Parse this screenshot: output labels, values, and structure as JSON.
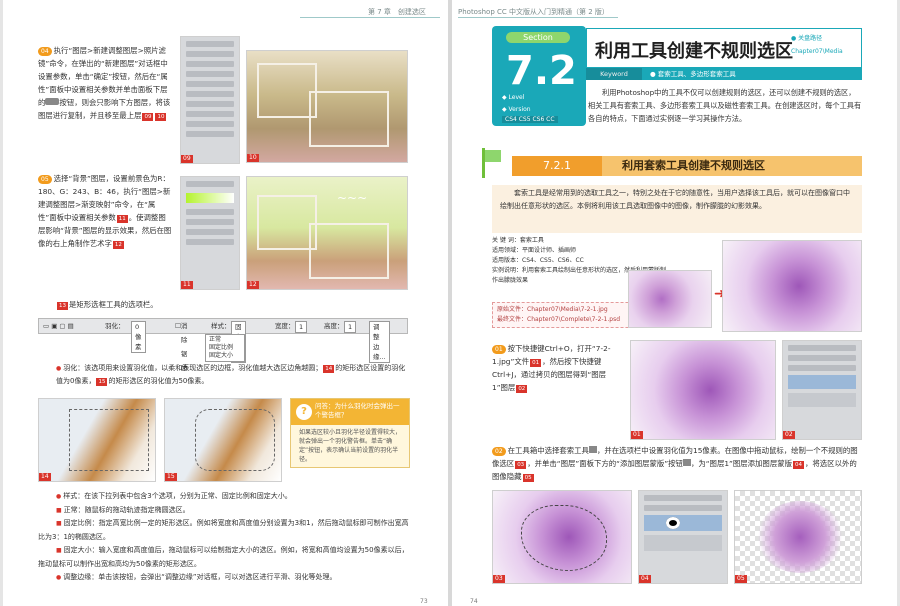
{
  "left": {
    "running_head": "第 7 章　创建选区",
    "p04": {
      "num": "04",
      "text": "执行“图层>新建调整图层>照片滤镜”命令，在弹出的“新建图层”对话框中设置参数，单击“确定”按钮，然后在“属性”面板中设置相关参数并单击面板下层的",
      "text2": "按钮，则会只影响下方图层，将该图层进行复制，并且移至最上层",
      "ref_a": "09",
      "ref_b": "10"
    },
    "p05": {
      "num": "05",
      "text": "选择“背景”图层，设置前景色为R：180、G：243、B：46，执行“图层>新建调整图层>渐变映射”命令，在“属性”面板中设置相关参数",
      "ref_a": "11",
      "text2": "。使调整图层影响“背景”图层的显示效果，然后在图像的右上角制作艺术字",
      "ref_b": "12"
    },
    "caption13": {
      "ref": "13",
      "text": "是矩形选框工具的选项栏。"
    },
    "optbar": {
      "feather_label": "羽化：",
      "feather_value": "0 像素",
      "antialias": "消除锯齿",
      "style_label": "样式：",
      "style_value": "固定比例",
      "width_label": "宽度：",
      "width_value": "1",
      "height_label": "高度：",
      "height_value": "1",
      "refine": "调整边缘..."
    },
    "dropdown": [
      "正常",
      "固定比例",
      "固定大小"
    ],
    "bullet1": {
      "text": "羽化：该选项用来设置羽化值，以柔和表现选区的边框，羽化值越大选区边角越圆；",
      "ref_a": "14",
      "text2": "的矩形选区设置的羽化值为0像素，",
      "ref_b": "15",
      "text3": "的矩形选区的羽化值为50像素。"
    },
    "tip": {
      "head": "问答：为什么羽化时会弹出一个警告框？",
      "body": "如果选区较小且羽化半径设置得较大，就会弹出一个羽化警告框。单击“确定”按钮，表示确认当前设置的羽化半径。"
    },
    "bullet2": "样式：在该下拉列表中包含3个选项，分别为正常、固定比例和固定大小。",
    "b2a": "正常：随鼠标的拖动轨迹指定椭圆选区。",
    "b2b": "固定比例：指定高宽比例一定的矩形选区。例如将宽度和高度值分别设置为3和1，然后拖动鼠标即可制作出宽高比为3：1的椭圆选区。",
    "b2c": "固定大小：输入宽度和高度值后，拖动鼠标可以绘制指定大小的选区。例如，将宽和高值均设置为50像素以后，拖动鼠标可以制作出宽和高均为50像素的矩形选区。",
    "bullet3": "调整边缘：单击该按钮，会弹出“调整边缘”对话框，可以对选区进行平滑、羽化等处理。",
    "figure_tags": [
      "09",
      "10",
      "11",
      "12",
      "13",
      "14",
      "15"
    ],
    "page_number": "73"
  },
  "right": {
    "running_head": "Photoshop CC 中文版从入门到精通（第 2 版）",
    "section": {
      "label": "Section",
      "number": "7.2",
      "level_label": "Level",
      "version_label": "Version",
      "version_value": "CS4 CS5 CS6 CC",
      "title": "利用工具创建不规则选区",
      "side_label": "关盘路径",
      "side_path": "Chapter07\\Media",
      "keyword_label": "Keyword",
      "keywords": "● 套索工具、多边形套索工具"
    },
    "intro_para": "利用Photoshop中的工具不仅可以创建规则的选区，还可以创建不规则的选区，相关工具有套索工具、多边形套索工具以及磁性套索工具。在创建选区时，每个工具有各自的特点，下面通过实例逐一学习其操作方法。",
    "h2": {
      "num": "7.2.1",
      "title": "利用套索工具创建不规则选区"
    },
    "intro_box": "套索工具是经常用到的选取工具之一，特别之处在于它的随意性，当用户选择该工具后，就可以在图像窗口中绘制出任意形状的选区。本例将利用该工具选取图像中的图像，制作朦胧的幻影效果。",
    "info": {
      "keyword": "关 键 词：套索工具",
      "field": "适用领域：平面设计师、插画师",
      "version": "适用版本：CS4、CS5、CS6、CC",
      "content": "实例说明：利用套索工具绘制出任意形状的选区，然后利用蒙版制作出朦胧效果"
    },
    "files": {
      "source": "原始文件：Chapter07\\Media\\7-2-1.jpg",
      "final": "最终文件：Chapter07\\Complete\\7-2-1.psd"
    },
    "s01": {
      "num": "01",
      "text": "按下快捷键Ctrl+O，打开“7-2-1.jpg”文件",
      "ref_a": "01",
      "text2": "，然后按下快捷键Ctrl+J，通过拷贝的图层得到“图层1”图层",
      "ref_b": "02"
    },
    "s02": {
      "num": "02",
      "text": "在工具箱中选择套索工具",
      "text2": "，并在选项栏中设置羽化值为15像素。在图像中拖动鼠标，绘制一个不规则的图像选区",
      "ref_a": "03",
      "text3": "，并单击“图层”面板下方的“添加图层蒙版”按钮",
      "text4": "，为“图层1”图层添加图层蒙版",
      "ref_b": "04",
      "text5": "，将选区以外的图像隐藏",
      "ref_c": "05"
    },
    "figure_tags": [
      "01",
      "02",
      "03",
      "04",
      "05"
    ],
    "page_number": "74"
  }
}
